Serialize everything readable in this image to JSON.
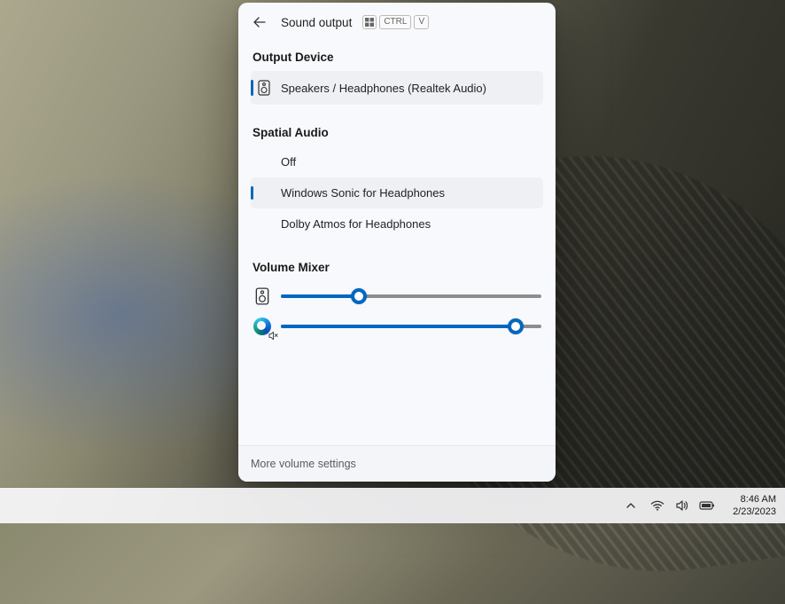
{
  "flyout": {
    "title": "Sound output",
    "shortcut_keys": [
      "CTRL",
      "V"
    ],
    "output_device": {
      "heading": "Output Device",
      "items": [
        {
          "label": "Speakers / Headphones (Realtek Audio)",
          "selected": true
        }
      ]
    },
    "spatial_audio": {
      "heading": "Spatial Audio",
      "items": [
        {
          "label": "Off",
          "selected": false
        },
        {
          "label": "Windows Sonic for Headphones",
          "selected": true
        },
        {
          "label": "Dolby Atmos for Headphones",
          "selected": false
        }
      ]
    },
    "volume_mixer": {
      "heading": "Volume Mixer",
      "channels": [
        {
          "name": "system-speakers",
          "value": 30,
          "muted": false
        },
        {
          "name": "microsoft-edge",
          "value": 90,
          "muted": true
        }
      ]
    },
    "footer_link": "More volume settings"
  },
  "taskbar": {
    "time": "8:46 AM",
    "date": "2/23/2023"
  },
  "colors": {
    "accent": "#0067c0"
  }
}
